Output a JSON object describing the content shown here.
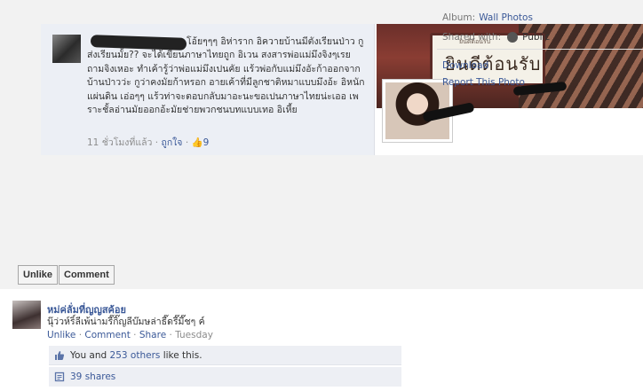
{
  "photo": {
    "post_text": "โอ้ยๆๆๆ อิห่าราก อิควายบ้านมีตังเรียนป่าว กูส่งเรียนมั้ย?? จะได้เขียนภาษาไทยถูก อิเวน สงสารพ่อแม่มึงจิงๆเรย ถามจิงเหอะ ทำเค้ารู้ว่าพ่อแม่มึงเปนคัย แร้วพ่อกับแม่มึงอัะก้าออกจากบ้านป่าวว่ะ กูว่าคงมัยก้าหรอก อายเค้าที่มีลูกชาติหมาแบบมึงอ้ะ อิหนักแผ่นดิน เอ่อๆๆ แร้วท่าจะตอบกลับมาอะนะขอเปนภาษาไทยน่ะเออ เพราะชั้ลอ่านมัยออกอ้ะมัยช่ายพวกชนบทแบบเทอ อิเหี้ย",
    "post_time": "11 ชั่วโมงที่แล้ว",
    "post_like_link": "ถูกใจ",
    "post_like_count": "9",
    "cover_sign_text": "ยินดีต้อนรับ",
    "cover_sign_small": "ยินดีต้อนรับ"
  },
  "buttons": {
    "unlike": "Unlike",
    "comment": "Comment"
  },
  "owner": {
    "name": "หม่ค่ลั่มที่ญญสค้อย",
    "caption": "นุ๊ว่วห์ริ์ลีเพ้น่ามรี๊กิ๊ญลีบ๊มษล่าธี๊ดรี๊มี๊ชๆ ค์",
    "actions": {
      "unlike": "Unlike",
      "comment": "Comment",
      "share": "Share",
      "time": "Tuesday"
    }
  },
  "likes": {
    "prefix": "You and ",
    "others": "253 others",
    "suffix": " like this."
  },
  "shares": {
    "text": "39 shares"
  },
  "sidebar": {
    "album_label": "Album:",
    "album_value": "Wall Photos",
    "shared_label": "Shared with:",
    "shared_value": "Public",
    "download": "Download",
    "report": "Report This Photo"
  },
  "colors": {
    "link": "#3b5998",
    "photo_bg": "#f2f2f2",
    "box_bg": "#edeff4"
  },
  "icons": {
    "like": "thumbs-up-icon",
    "share": "share-icon",
    "audience": "globe-icon"
  }
}
